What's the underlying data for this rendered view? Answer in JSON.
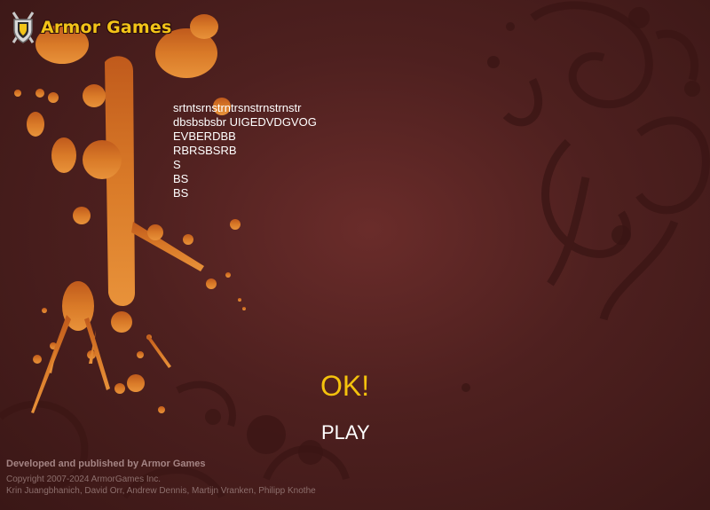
{
  "brand": {
    "name": "Armor Games"
  },
  "message_lines": [
    "srtntsrnstrntrsnstrnstrnstr",
    "dbsbsbsbr UIGEDVDGVOG",
    "EVBERDBB",
    "RBRSBSRB",
    "S",
    "BS",
    "BS"
  ],
  "buttons": {
    "ok_label": "OK!",
    "play_label": "PLAY"
  },
  "credits": {
    "developed_by": "Developed and published by Armor Games",
    "copyright": "Copyright 2007-2024 ArmorGames Inc.",
    "names": "Krin Juangbhanich, David Orr, Andrew Dennis, Martijn Vranken, Philipp Knothe"
  },
  "colors": {
    "background": "#4e201f",
    "splatter": "#e0842c",
    "accent": "#f4c20d",
    "text": "#ffffff"
  }
}
